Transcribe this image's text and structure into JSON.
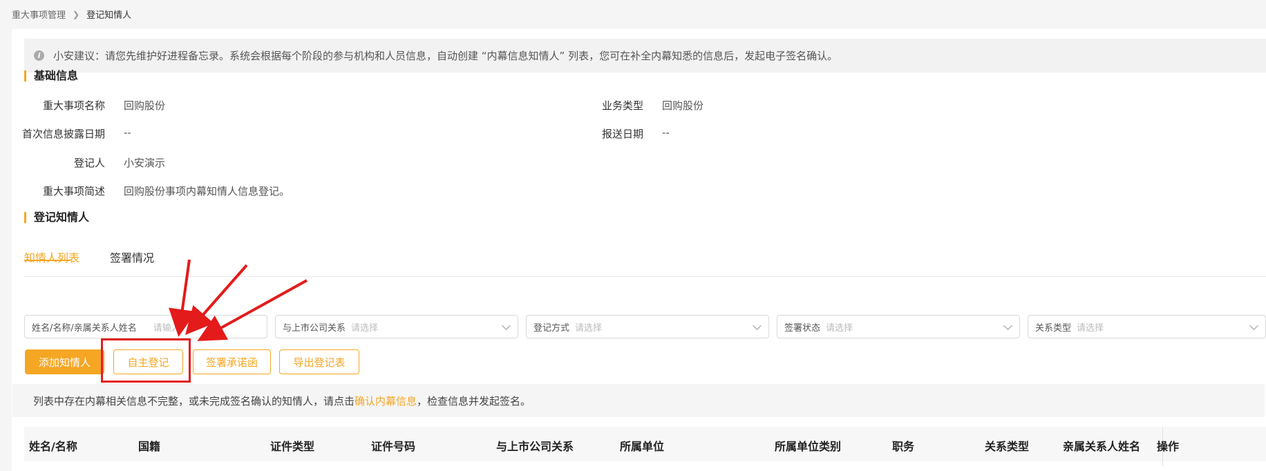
{
  "breadcrumb": {
    "parent": "重大事项管理",
    "current": "登记知情人"
  },
  "tip": {
    "text": "小安建议：请您先维护好进程备忘录。系统会根据每个阶段的参与机构和人员信息，自动创建 “内幕信息知情人” 列表，您可在补全内幕知悉的信息后，发起电子签名确认。"
  },
  "basic": {
    "title": "基础信息",
    "fields": [
      {
        "label": "重大事项名称",
        "value": "回购股份"
      },
      {
        "label": "业务类型",
        "value": "回购股份"
      },
      {
        "label": "首次信息披露日期",
        "value": "--"
      },
      {
        "label": "报送日期",
        "value": "--"
      },
      {
        "label": "登记人",
        "value": "小安演示"
      },
      {
        "label": "重大事项简述",
        "value": "回购股份事项内幕知情人信息登记。"
      }
    ]
  },
  "register": {
    "title": "登记知情人"
  },
  "tabs": [
    {
      "label": "知情人列表",
      "active": true
    },
    {
      "label": "签署情况",
      "active": false
    }
  ],
  "filters": [
    {
      "label": "姓名/名称/亲属关系人姓名",
      "placeholder": "请输入"
    },
    {
      "label": "与上市公司关系",
      "placeholder": "请选择"
    },
    {
      "label": "登记方式",
      "placeholder": "请选择"
    },
    {
      "label": "签署状态",
      "placeholder": "请选择"
    },
    {
      "label": "关系类型",
      "placeholder": "请选择"
    }
  ],
  "actions": {
    "add": "添加知情人",
    "self_register": "自主登记",
    "sign": "签署承诺函",
    "export": "导出登记表"
  },
  "notice": {
    "before": "列表中存在内幕相关信息不完整，或未完成签名确认的知情人，请点击",
    "link": "确认内幕信息",
    "after": "，检查信息并发起签名。"
  },
  "table": {
    "headers": [
      "姓名/名称",
      "国籍",
      "证件类型",
      "证件号码",
      "与上市公司关系",
      "所属单位",
      "所属单位类别",
      "职务",
      "关系类型",
      "亲属关系人姓名",
      "操作"
    ]
  },
  "colors": {
    "accent": "#f5a623",
    "annotation": "#e41b1b"
  }
}
